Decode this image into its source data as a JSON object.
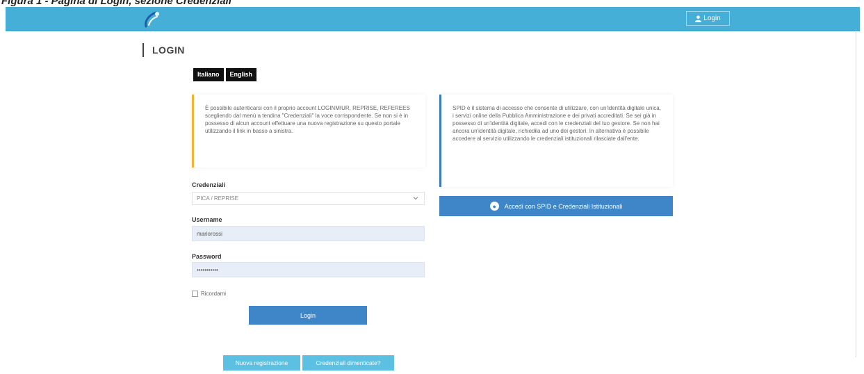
{
  "caption": "Figura 1 - Pagina di Login, sezione Credenziali",
  "header": {
    "login_label": "Login",
    "user_icon": "user-icon",
    "brand_color": "#45afd8"
  },
  "page": {
    "title": "LOGIN"
  },
  "languages": [
    "Italiano",
    "English"
  ],
  "info_left": "È possibile autenticarsi con il proprio account LOGINMIUR, REPRISE, REFEREES scegliendo dal menù a tendina \"Credenziali\" la voce corrispondente. Se non si è in possesso di alcun account effettuare una nuova registrazione su questo portale utilizzando il link in basso a sinistra.",
  "info_right": "SPID è il sistema di accesso che consente di utilizzare, con un'identità digitale unica, i servizi online della Pubblica Amministrazione e dei privati accreditati. Se sei già in possesso di un'identità digitale, accedi con le credenziali del tuo gestore. Se non hai ancora un'identità digitale, richiedila ad uno dei gestori. In alternativa è possibile accedere al servizio utilizzando le credenziali istituzionali rilasciate dall'ente.",
  "form": {
    "credentials_label": "Credenziali",
    "credentials_value": "PICA / REPRISE",
    "username_label": "Username",
    "username_value": "mariorossi",
    "password_label": "Password",
    "password_value": "•••••••••••",
    "remember_label": "Ricordami",
    "login_button": "Login"
  },
  "spid_button": "Accedi con SPID e Credenziali Istituzionali",
  "links": {
    "register": "Nuova registrazione",
    "forgot": "Credenziali dimenticate?"
  }
}
